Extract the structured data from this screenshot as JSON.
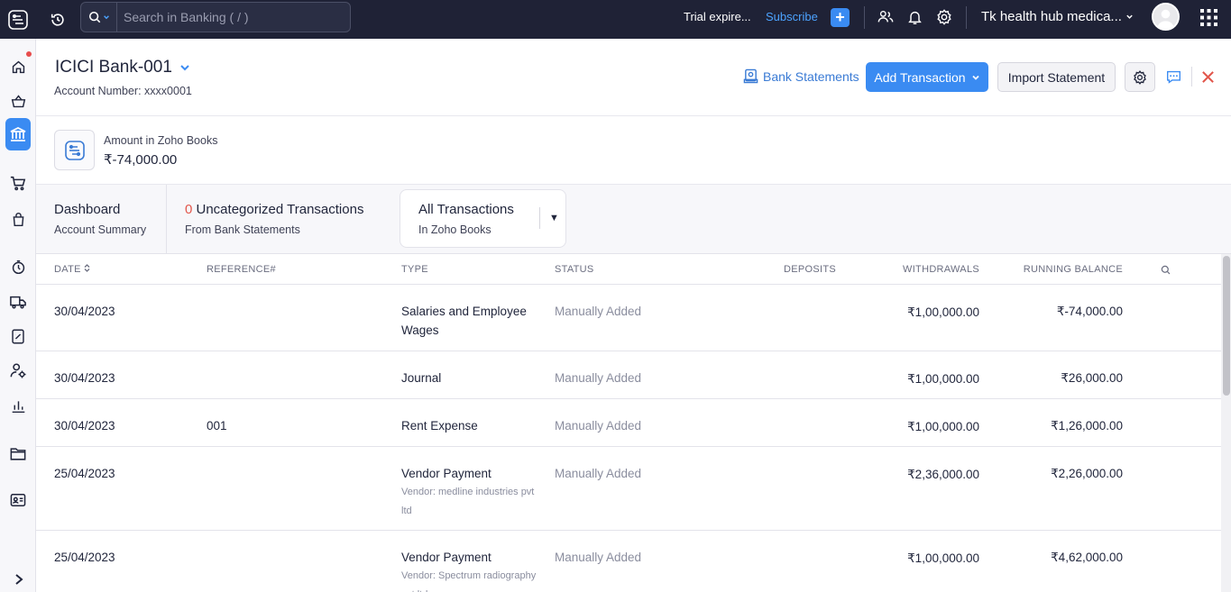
{
  "topbar": {
    "search_placeholder": "Search in Banking ( / )",
    "trial_text": "Trial expire...",
    "subscribe_label": "Subscribe",
    "org_name": "Tk health hub medica..."
  },
  "header": {
    "account_title": "ICICI Bank-001",
    "account_number": "Account Number: xxxx0001",
    "bank_statements_label": "Bank Statements",
    "add_transaction_label": "Add Transaction",
    "import_statement_label": "Import Statement"
  },
  "amount": {
    "label": "Amount in Zoho Books",
    "value": "₹-74,000.00"
  },
  "tabs": {
    "dashboard": {
      "title": "Dashboard",
      "subtitle": "Account Summary"
    },
    "uncategorized": {
      "count": "0",
      "title": " Uncategorized Transactions",
      "subtitle": "From Bank Statements"
    },
    "all": {
      "title": "All Transactions",
      "subtitle": "In Zoho Books"
    }
  },
  "table": {
    "headers": {
      "date": "DATE",
      "reference": "REFERENCE#",
      "type": "TYPE",
      "status": "STATUS",
      "deposits": "DEPOSITS",
      "withdrawals": "WITHDRAWALS",
      "running_balance": "RUNNING BALANCE"
    },
    "rows": [
      {
        "date": "30/04/2023",
        "reference": "",
        "type": "Salaries and Employee Wages",
        "sub": "",
        "status": "Manually Added",
        "deposits": "",
        "withdrawals": "₹1,00,000.00",
        "balance": "₹-74,000.00"
      },
      {
        "date": "30/04/2023",
        "reference": "",
        "type": "Journal",
        "sub": "",
        "status": "Manually Added",
        "deposits": "",
        "withdrawals": "₹1,00,000.00",
        "balance": "₹26,000.00"
      },
      {
        "date": "30/04/2023",
        "reference": "001",
        "type": "Rent Expense",
        "sub": "",
        "status": "Manually Added",
        "deposits": "",
        "withdrawals": "₹1,00,000.00",
        "balance": "₹1,26,000.00"
      },
      {
        "date": "25/04/2023",
        "reference": "",
        "type": "Vendor Payment",
        "sub": "Vendor: medline industries pvt ltd",
        "status": "Manually Added",
        "deposits": "",
        "withdrawals": "₹2,36,000.00",
        "balance": "₹2,26,000.00"
      },
      {
        "date": "25/04/2023",
        "reference": "",
        "type": "Vendor Payment",
        "sub": "Vendor: Spectrum radiography pvt ltd",
        "status": "Manually Added",
        "deposits": "",
        "withdrawals": "₹1,00,000.00",
        "balance": "₹4,62,000.00"
      }
    ]
  },
  "colors": {
    "topbar_bg": "#1f2236",
    "accent": "#3a8bf2",
    "danger": "#e2574c"
  }
}
